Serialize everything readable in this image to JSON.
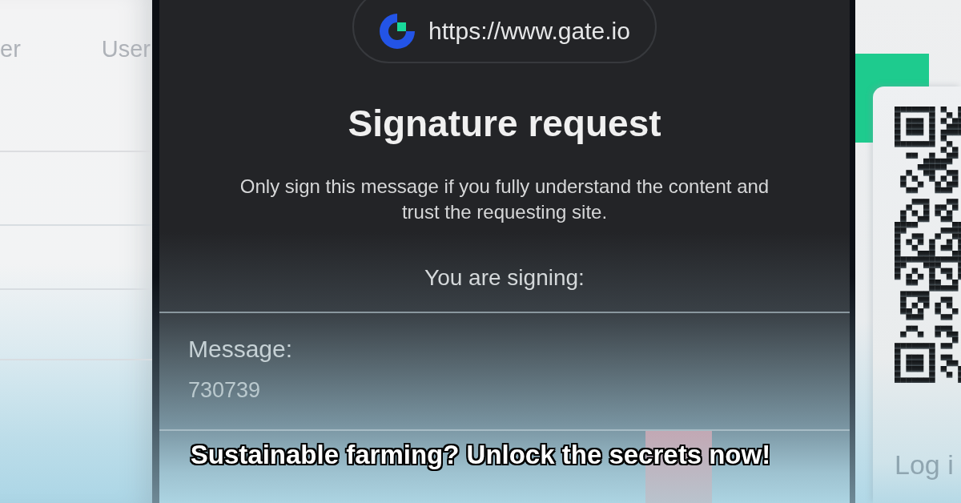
{
  "background_page": {
    "table_headers": [
      "er",
      "User"
    ],
    "login_label": "Log i"
  },
  "signature_dialog": {
    "origin": "https://www.gate.io",
    "title": "Signature request",
    "warning": "Only sign this message if you fully understand the content and trust the requesting site.",
    "signing_label": "You are signing:",
    "message_label": "Message:",
    "message_value": "730739"
  },
  "caption": "Sustainable farming? Unlock the secrets now!"
}
